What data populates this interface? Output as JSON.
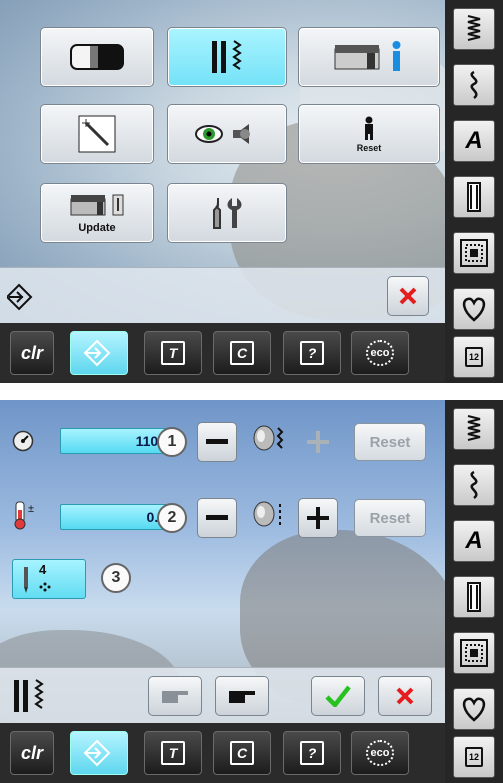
{
  "setup_menu": {
    "update_label": "Update",
    "reset_label": "Reset"
  },
  "bottom_bar": {
    "clr_label": "clr",
    "t_label": "T",
    "c_label": "C",
    "q_label": "?",
    "eco_label": "eco"
  },
  "sidebar": {
    "alphabet_label": "A",
    "pages_label": "12"
  },
  "stitch_settings": {
    "speed_value": "1100",
    "tension_value": "0.0",
    "reset_label": "Reset",
    "callouts": [
      "1",
      "2",
      "3"
    ],
    "needle_position": "4"
  },
  "colors": {
    "accent_cyan": "#74e2f7",
    "confirm_green": "#27c21f",
    "cancel_red": "#e41e1e"
  }
}
